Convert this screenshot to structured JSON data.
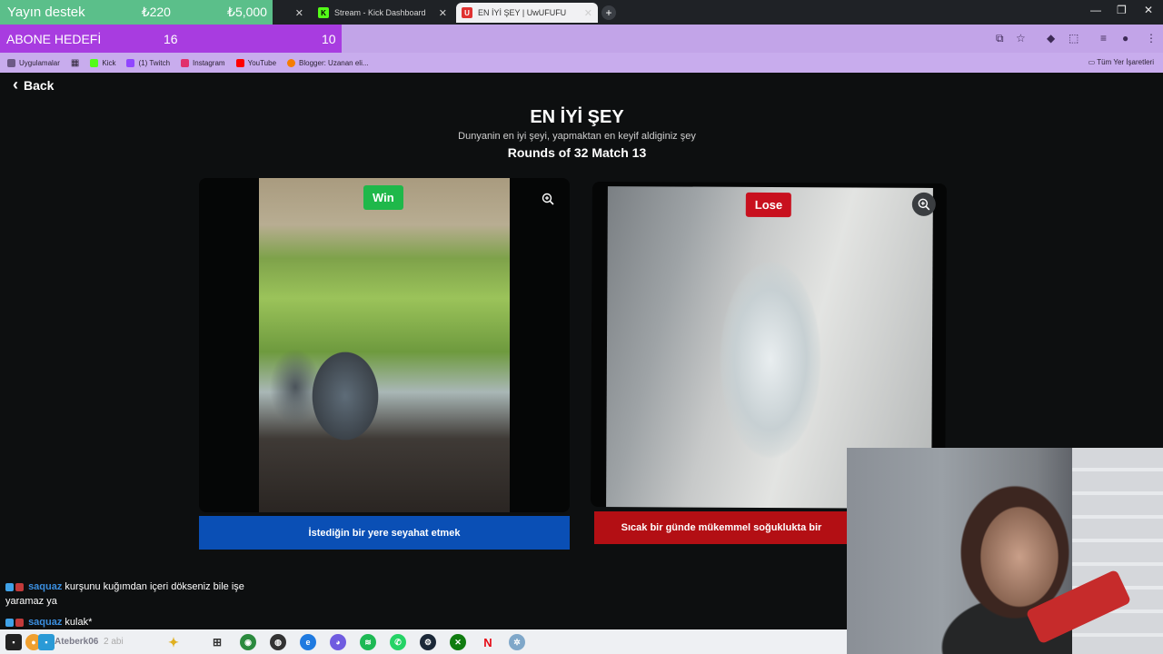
{
  "overlay": {
    "donation_label": "Yayın destek",
    "donation_current": "₺220",
    "donation_target": "₺5,000",
    "goal_label": "ABONE HEDEFİ",
    "goal_current": "16",
    "goal_target": "10"
  },
  "tabs": [
    {
      "label": "Stream - Kick Dashboard",
      "icon": "kick-icon"
    },
    {
      "label": "EN İYİ ŞEY | UwUFUFU",
      "icon": "uwufufu-icon"
    }
  ],
  "bookmarks": [
    {
      "label": "Uygulamalar"
    },
    {
      "label": "Kick"
    },
    {
      "label": "(1) Twitch"
    },
    {
      "label": "Instagram"
    },
    {
      "label": "YouTube"
    },
    {
      "label": "Blogger: Uzanan eli..."
    }
  ],
  "bookmarks_right": "Tüm Yer İşaretleri",
  "page": {
    "back_label": "Back",
    "title": "EN İYİ ŞEY",
    "subtitle": "Dunyanin en iyi şeyi, yapmaktan en keyif aldiginiz şey",
    "round_info": "Rounds of 32 Match 13"
  },
  "left_choice": {
    "badge": "Win",
    "label": "İstediğin bir yere seyahat etmek",
    "badge_color": "#1fb84a",
    "button_color": "#0a4fb5"
  },
  "right_choice": {
    "badge": "Lose",
    "label": "Sıcak bir günde mükemmel soğuklukta bir",
    "badge_color": "#c8101e",
    "button_color": "#b30f14"
  },
  "chat": [
    {
      "user": "saquaz",
      "message": "kurşunu kuğımdan içeri dökseniz bile işe",
      "continued": "yaramaz ya"
    },
    {
      "user": "saquaz",
      "message": "kulak*"
    }
  ],
  "taskbar": {
    "user_text": "Ateberk06",
    "extra_text": "2 abi"
  }
}
